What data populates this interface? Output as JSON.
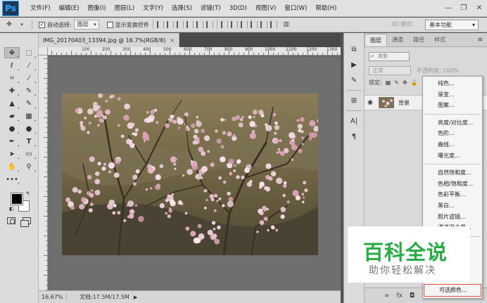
{
  "app": {
    "logo": "Ps"
  },
  "menubar": {
    "items": [
      "文件(F)",
      "编辑(E)",
      "图像(I)",
      "图层(L)",
      "文字(Y)",
      "选择(S)",
      "滤镜(T)",
      "3D(D)",
      "视图(V)",
      "窗口(W)",
      "帮助(H)"
    ],
    "window_controls": [
      "—",
      "❐",
      "✕"
    ]
  },
  "options": {
    "auto_select_label": "自动选择:",
    "auto_select_checked": true,
    "auto_select_value": "图层",
    "show_transform_label": "显示变换控件",
    "show_transform_checked": false,
    "mode3d_label": "3D 模式:",
    "workspace": "基本功能"
  },
  "document": {
    "tab_title": "IMG_20170403_13394.jpg @ 16.7%(RGB/8)",
    "tab_close": "×",
    "ruler_labels": [
      "100",
      "200",
      "300",
      "400",
      "500",
      "600",
      "700",
      "800",
      "900",
      "1000",
      "1100",
      "1200",
      "1300"
    ],
    "zoom": "16.67%",
    "doc_info": "文档:17.5M/17.5M",
    "status_arrow": "▶"
  },
  "layers_panel": {
    "tabs": [
      "图层",
      "通道",
      "路径",
      "样式"
    ],
    "active_tab": "图层",
    "filter_label": "类型",
    "blend_mode": "正常",
    "opacity_label": "不透明度: 100%",
    "lock_label": "锁定:",
    "layer_name": "背景",
    "bottom_icons": [
      "∞",
      "fx",
      "◘"
    ]
  },
  "adjustment_menu": {
    "items": [
      [
        "纯色...",
        "渐变...",
        "图案..."
      ],
      [
        "亮度/对比度...",
        "色阶...",
        "曲线...",
        "曝光度..."
      ],
      [
        "自然饱和度...",
        "色相/饱和度...",
        "色彩平衡...",
        "黑白...",
        "照片滤镜...",
        "通道混合器..."
      ],
      [
        "可选颜色..."
      ]
    ],
    "highlighted": "可选颜色..."
  },
  "watermark": {
    "title": "百科全说",
    "subtitle": "助你轻松解决"
  },
  "colors": {
    "foreground": "#000000",
    "background": "#ffffff",
    "watermark_green": "#2bab46"
  }
}
